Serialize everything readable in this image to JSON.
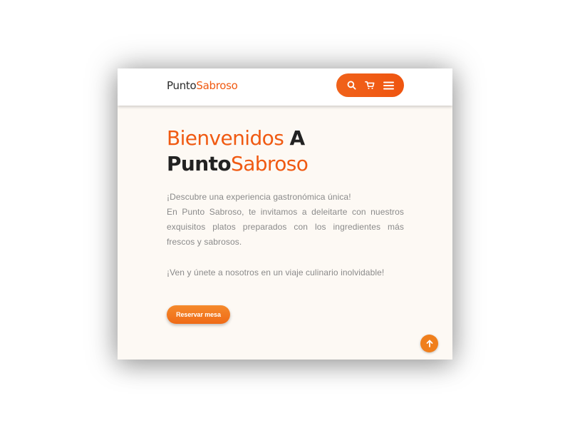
{
  "brand": {
    "name_part1": "Punto",
    "name_part2": "Sabroso",
    "accent_color": "#f05a12"
  },
  "nav": {
    "icons": [
      "search-icon",
      "cart-icon",
      "menu-icon"
    ]
  },
  "hero": {
    "title_orange": "Bienvenidos",
    "title_bold_a": "A",
    "title_line2_bold": "Punto",
    "title_line2_orange": "Sabroso",
    "paragraph_1_line_1": "¡Descubre una experiencia gastronómica única!",
    "paragraph_1_line_2": "En Punto Sabroso, te invitamos a deleitarte con nuestros exquisitos platos preparados con los ingredientes más frescos y sabrosos.",
    "paragraph_2": "¡Ven y únete a nosotros en un viaje culinario inolvidable!"
  },
  "cta": {
    "reserve_label": "Reservar mesa"
  },
  "scroll_top": {
    "icon": "arrow-up-icon"
  }
}
